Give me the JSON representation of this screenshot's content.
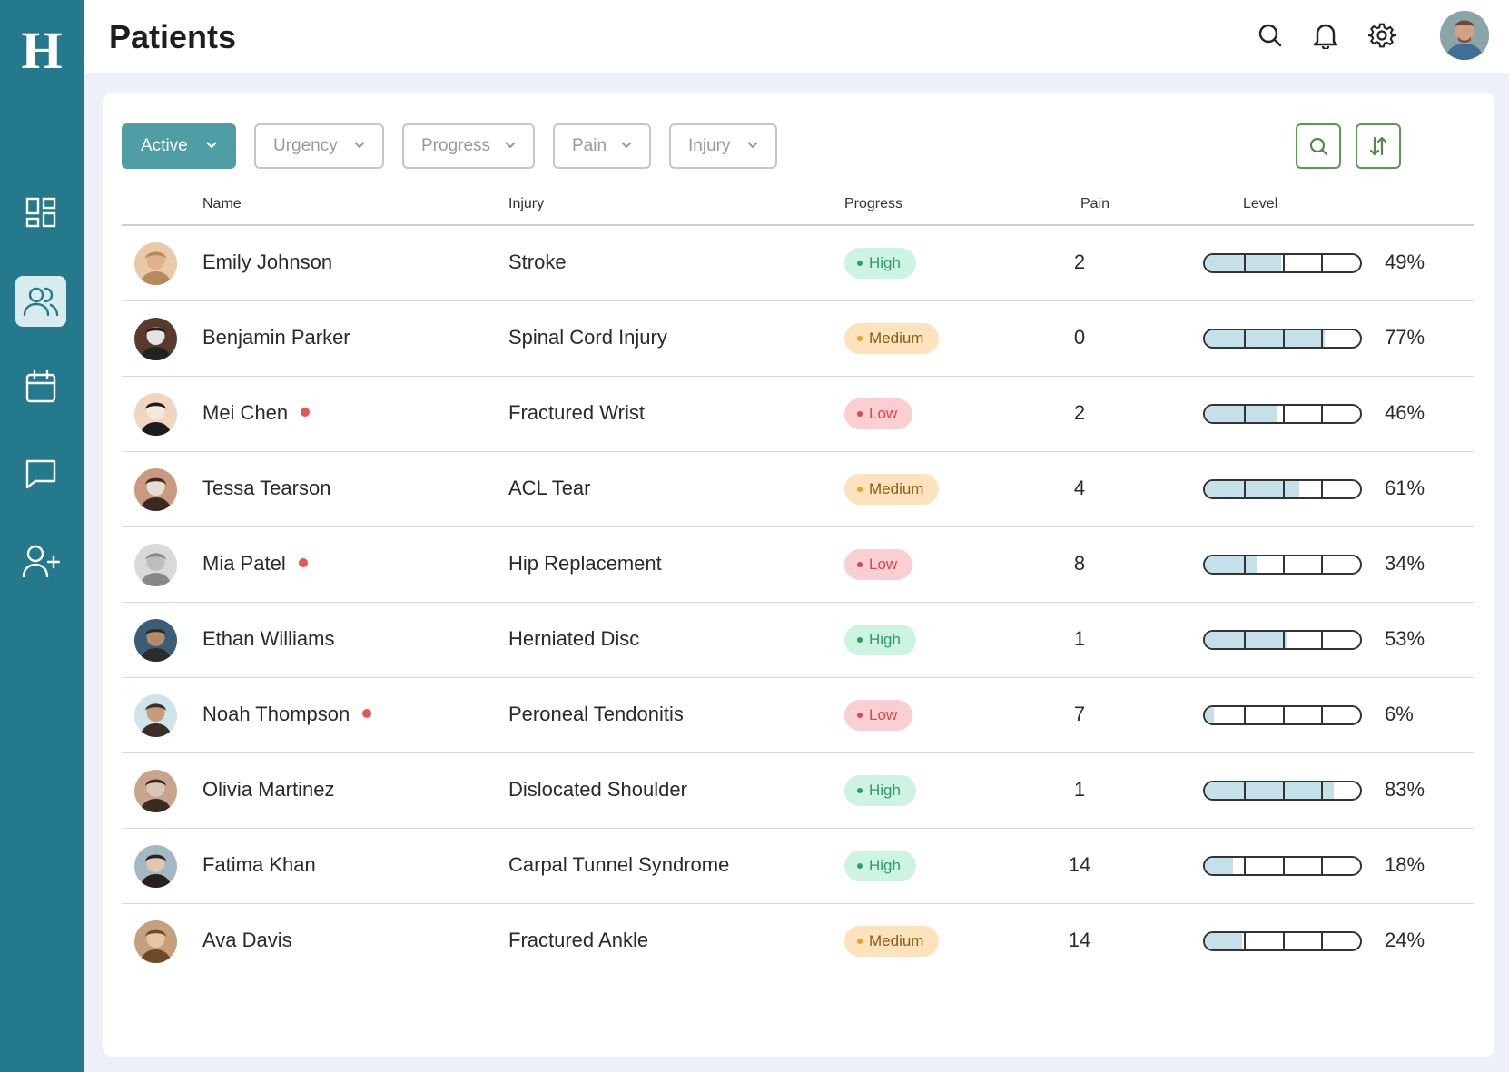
{
  "app": {
    "logo_text": "H"
  },
  "header": {
    "title": "Patients"
  },
  "sidebar": {
    "items": [
      {
        "icon": "dashboard-icon",
        "active": false
      },
      {
        "icon": "users-icon",
        "active": true
      },
      {
        "icon": "calendar-icon",
        "active": false
      },
      {
        "icon": "message-icon",
        "active": false
      },
      {
        "icon": "add-user-icon",
        "active": false
      }
    ]
  },
  "filters": {
    "active": "Active",
    "urgency": "Urgency",
    "progress": "Progress",
    "pain": "Pain",
    "injury": "Injury"
  },
  "table": {
    "columns": {
      "name": "Name",
      "injury": "Injury",
      "progress": "Progress",
      "pain": "Pain",
      "level": "Level"
    },
    "rows": [
      {
        "name": "Emily Johnson",
        "flag": false,
        "injury": "Stroke",
        "progress": "High",
        "pain": "2",
        "level": 49,
        "level_label": "49%"
      },
      {
        "name": "Benjamin Parker",
        "flag": false,
        "injury": "Spinal Cord Injury",
        "progress": "Medium",
        "pain": "0",
        "level": 77,
        "level_label": "77%"
      },
      {
        "name": "Mei Chen",
        "flag": true,
        "injury": "Fractured Wrist",
        "progress": "Low",
        "pain": "2",
        "level": 46,
        "level_label": "46%"
      },
      {
        "name": "Tessa Tearson",
        "flag": false,
        "injury": "ACL Tear",
        "progress": "Medium",
        "pain": "4",
        "level": 61,
        "level_label": "61%"
      },
      {
        "name": "Mia Patel",
        "flag": true,
        "injury": "Hip Replacement",
        "progress": "Low",
        "pain": "8",
        "level": 34,
        "level_label": "34%"
      },
      {
        "name": "Ethan Williams",
        "flag": false,
        "injury": "Herniated Disc",
        "progress": "High",
        "pain": "1",
        "level": 53,
        "level_label": "53%"
      },
      {
        "name": "Noah Thompson",
        "flag": true,
        "injury": "Peroneal Tendonitis",
        "progress": "Low",
        "pain": "7",
        "level": 6,
        "level_label": "6%"
      },
      {
        "name": "Olivia Martinez",
        "flag": false,
        "injury": "Dislocated Shoulder",
        "progress": "High",
        "pain": "1",
        "level": 83,
        "level_label": "83%"
      },
      {
        "name": "Fatima Khan",
        "flag": false,
        "injury": "Carpal Tunnel Syndrome",
        "progress": "High",
        "pain": "14",
        "level": 18,
        "level_label": "18%"
      },
      {
        "name": "Ava Davis",
        "flag": false,
        "injury": "Fractured Ankle",
        "progress": "Medium",
        "pain": "14",
        "level": 24,
        "level_label": "24%"
      }
    ]
  },
  "colors": {
    "sidebar": "#247a8c",
    "accent": "#4f9ea6",
    "tool_border": "#5c9a52",
    "level_fill": "#c5e0e8"
  }
}
